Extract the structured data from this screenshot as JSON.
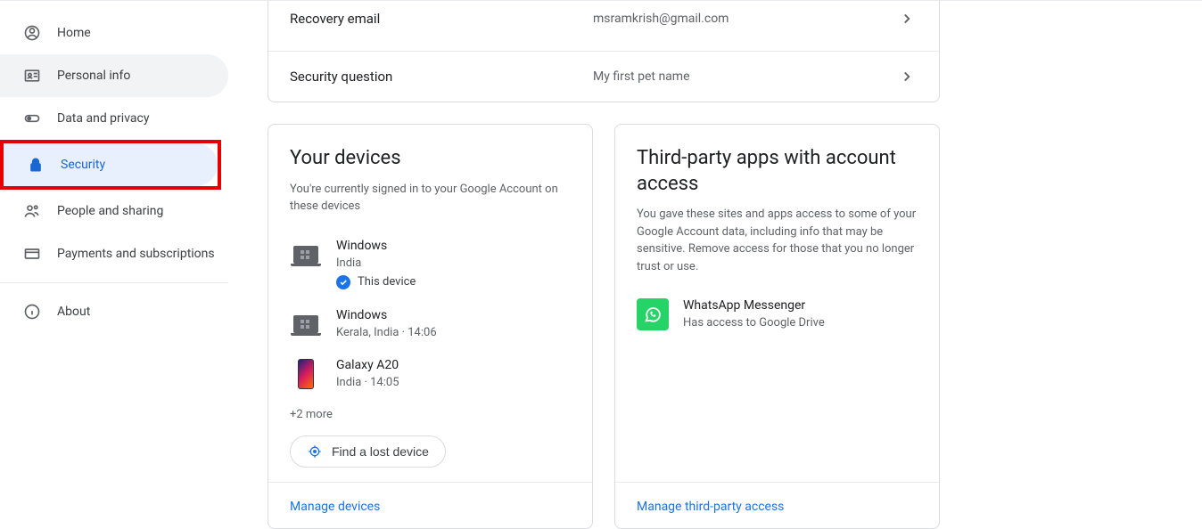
{
  "sidebar": {
    "items": [
      {
        "label": "Home"
      },
      {
        "label": "Personal info"
      },
      {
        "label": "Data and privacy"
      },
      {
        "label": "Security"
      },
      {
        "label": "People and sharing"
      },
      {
        "label": "Payments and subscriptions"
      },
      {
        "label": "About"
      }
    ]
  },
  "recovery": {
    "email_label": "Recovery email",
    "email_value": "msramkrish@gmail.com",
    "question_label": "Security question",
    "question_value": "My first pet name"
  },
  "devices_card": {
    "title": "Your devices",
    "subtitle": "You're currently signed in to your Google Account on these devices",
    "devices": [
      {
        "name": "Windows",
        "loc": "India",
        "this_device_label": "This device"
      },
      {
        "name": "Windows",
        "loc": "Kerala, India · 14:06"
      },
      {
        "name": "Galaxy A20",
        "loc": "India · 14:05"
      }
    ],
    "more": "+2 more",
    "find_lost": "Find a lost device",
    "manage": "Manage devices"
  },
  "thirdparty_card": {
    "title": "Third-party apps with account access",
    "subtitle": "You gave these sites and apps access to some of your Google Account data, including info that may be sensitive. Remove access for those that you no longer trust or use.",
    "apps": [
      {
        "name": "WhatsApp Messenger",
        "access": "Has access to Google Drive"
      }
    ],
    "manage": "Manage third-party access"
  }
}
